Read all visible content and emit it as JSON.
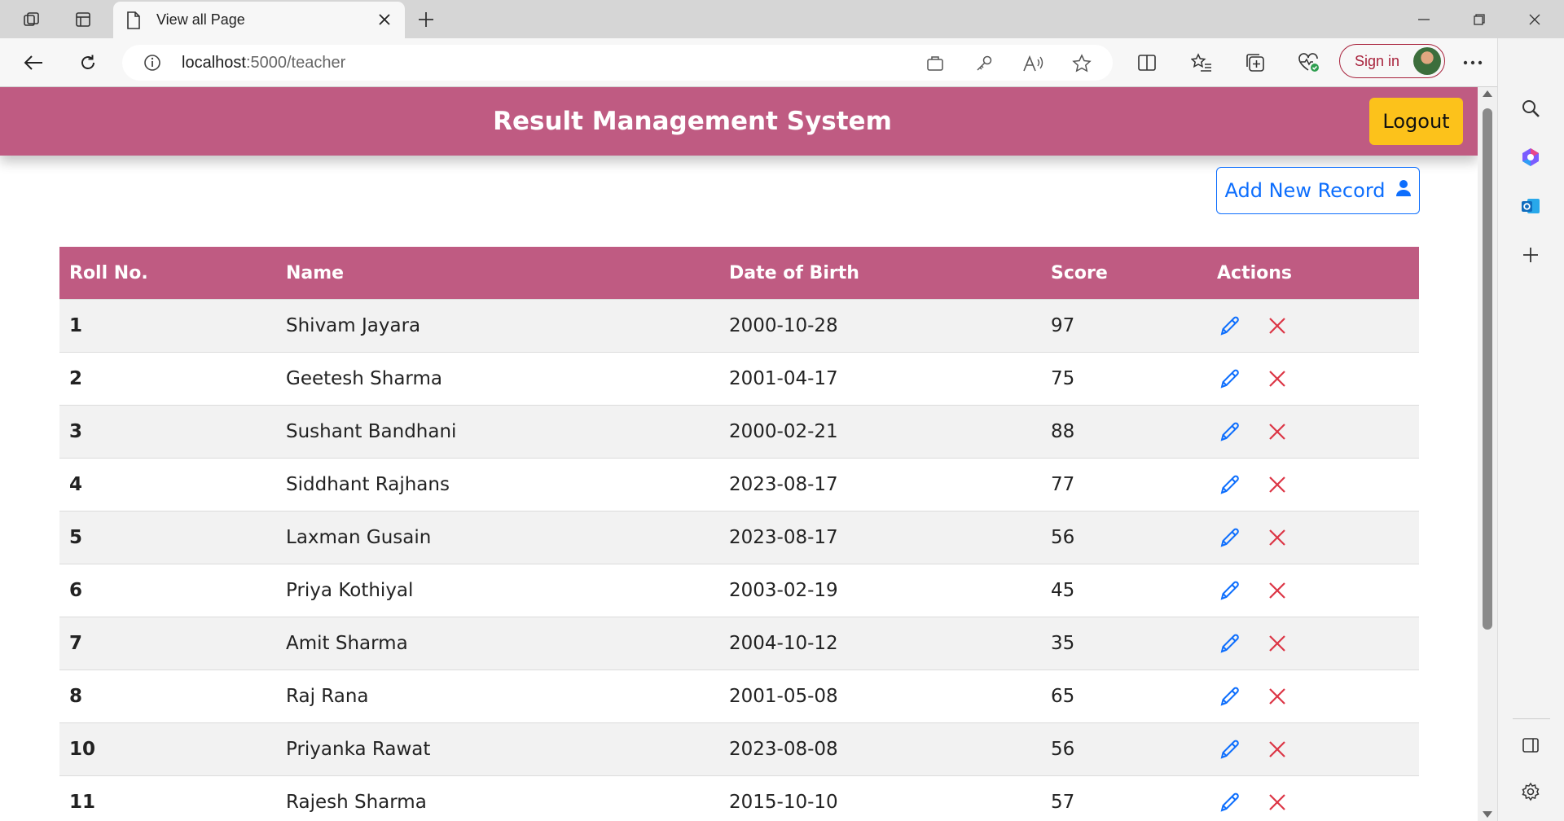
{
  "browser": {
    "tab_title": "View all Page",
    "url_host": "localhost",
    "url_path": ":5000/teacher",
    "sign_in_label": "Sign in"
  },
  "header": {
    "title": "Result Management System",
    "logout_label": "Logout"
  },
  "actions": {
    "add_record_label": "Add New Record"
  },
  "table": {
    "columns": [
      "Roll No.",
      "Name",
      "Date of Birth",
      "Score",
      "Actions"
    ],
    "rows": [
      {
        "roll": "1",
        "name": "Shivam Jayara",
        "dob": "2000-10-28",
        "score": "97"
      },
      {
        "roll": "2",
        "name": "Geetesh Sharma",
        "dob": "2001-04-17",
        "score": "75"
      },
      {
        "roll": "3",
        "name": "Sushant Bandhani",
        "dob": "2000-02-21",
        "score": "88"
      },
      {
        "roll": "4",
        "name": "Siddhant Rajhans",
        "dob": "2023-08-17",
        "score": "77"
      },
      {
        "roll": "5",
        "name": "Laxman Gusain",
        "dob": "2023-08-17",
        "score": "56"
      },
      {
        "roll": "6",
        "name": "Priya Kothiyal",
        "dob": "2003-02-19",
        "score": "45"
      },
      {
        "roll": "7",
        "name": "Amit Sharma",
        "dob": "2004-10-12",
        "score": "35"
      },
      {
        "roll": "8",
        "name": "Raj Rana",
        "dob": "2001-05-08",
        "score": "65"
      },
      {
        "roll": "10",
        "name": "Priyanka Rawat",
        "dob": "2023-08-08",
        "score": "56"
      },
      {
        "roll": "11",
        "name": "Rajesh Sharma",
        "dob": "2015-10-10",
        "score": "57"
      }
    ]
  },
  "colors": {
    "brand": "#bf5b82",
    "logout": "#fcc21b",
    "primary": "#0d6efd",
    "danger": "#dc3545"
  },
  "icons": {
    "edit": "pencil-icon",
    "delete": "close-x-icon",
    "add": "user-icon"
  }
}
